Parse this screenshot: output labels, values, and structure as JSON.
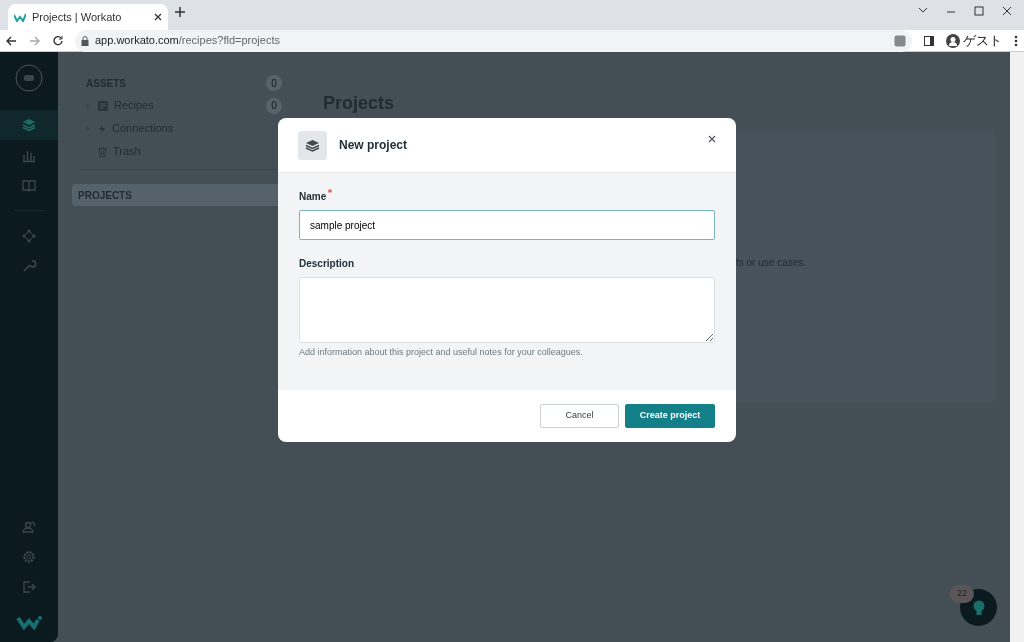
{
  "browser": {
    "tab_title": "Projects | Workato",
    "url_host": "app.workato.com",
    "url_path": "/recipes?fld=projects",
    "profile": "ゲスト"
  },
  "rail_items": [
    {
      "selected": true
    },
    {
      "selected": false
    },
    {
      "selected": false
    },
    {
      "selected": false
    },
    {
      "selected": false
    }
  ],
  "rail_bottom": [
    {
      "selected": false
    },
    {
      "selected": false
    },
    {
      "selected": false
    }
  ],
  "sidebar": {
    "sections": [
      {
        "label": "ASSETS",
        "count": "0",
        "selected": false,
        "items": [
          {
            "label": "Recipes",
            "count": "0",
            "expandable": true
          },
          {
            "label": "Connections",
            "expandable": true
          },
          {
            "label": "Trash",
            "expandable": false
          }
        ]
      },
      {
        "label": "PROJECTS",
        "selected": true
      }
    ]
  },
  "main": {
    "title": "Projects",
    "card_text_fragment": "ts or use cases."
  },
  "modal": {
    "title": "New project",
    "fields": [
      {
        "kind": "input",
        "label": "Name",
        "required": true,
        "value": "sample project"
      },
      {
        "kind": "textarea",
        "label": "Description",
        "required": false,
        "help": "Add information about this project and useful notes for your colleagues."
      }
    ],
    "buttons": [
      {
        "label": "Cancel",
        "primary": false
      },
      {
        "label": "Create project",
        "primary": true
      }
    ]
  },
  "help_button": {
    "badge": "22"
  }
}
